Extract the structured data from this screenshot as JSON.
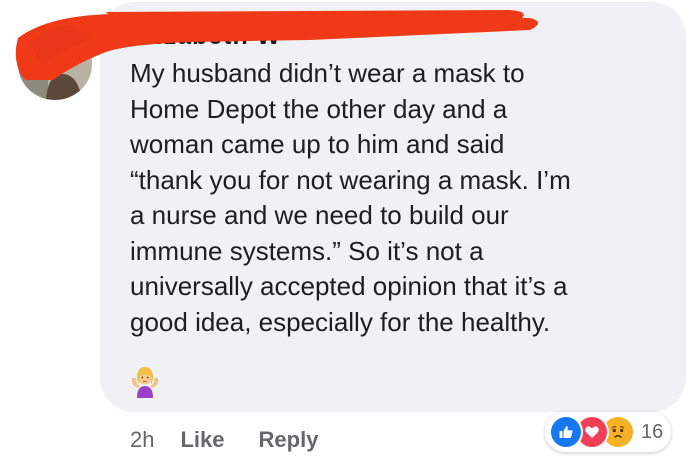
{
  "comment": {
    "author_name": "Elizabeth W",
    "text_lines": [
      "My husband didn’t wear a mask to",
      "Home Depot the other day and a",
      "woman came up to him and said",
      "“thank you for not wearing a mask. I’m",
      "a nurse and we need to build our",
      "immune systems.” So it’s not a",
      "universally accepted opinion that it’s a",
      "good idea, especially for the healthy."
    ],
    "emoji": "person-shrugging",
    "redaction_color": "#f03a17"
  },
  "actions": {
    "timestamp": "2h",
    "like_label": "Like",
    "reply_label": "Reply"
  },
  "reactions": {
    "icons": [
      "like-icon",
      "love-icon",
      "sad-icon"
    ],
    "count": "16"
  },
  "colors": {
    "bubble": "#eff1f4",
    "text": "#1c1e21",
    "secondary_text": "#65676b",
    "like": "#1877f2",
    "love": "#f33e58",
    "sad": "#f7b125"
  }
}
